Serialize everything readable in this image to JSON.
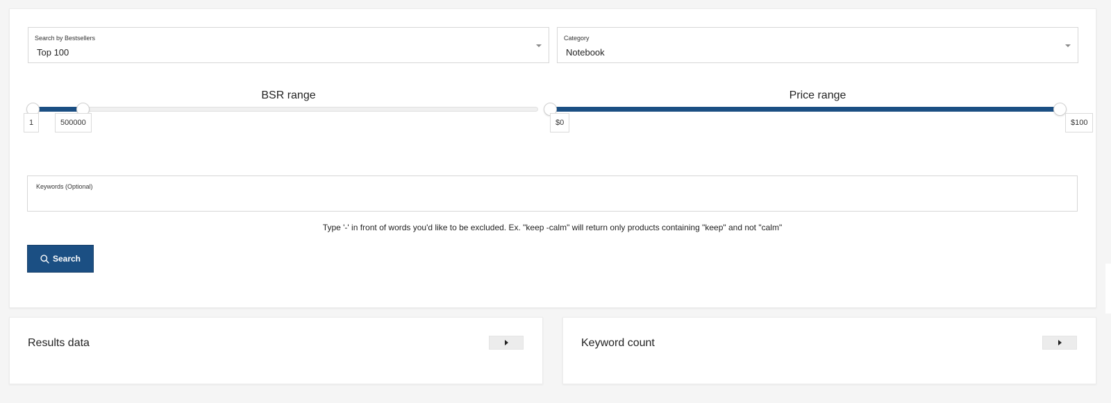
{
  "search_panel": {
    "bestsellers_select": {
      "label": "Search by Bestsellers",
      "value": "Top 100"
    },
    "category_select": {
      "label": "Category",
      "value": "Notebook"
    },
    "bsr_range": {
      "title": "BSR range",
      "min_label": "1",
      "max_label": "500000",
      "range_max": 5000000,
      "low": 1,
      "high": 500000
    },
    "price_range": {
      "title": "Price range",
      "min_label": "$0",
      "max_label": "$100",
      "range_max": 100,
      "low": 0,
      "high": 100
    },
    "keywords": {
      "label": "Keywords (Optional)",
      "value": ""
    },
    "hint": "Type '-' in front of words you'd like to be excluded. Ex. \"keep -calm\" will return only products containing \"keep\" and not \"calm\"",
    "search_button": {
      "label": "Search",
      "color": "#1b4f83"
    }
  },
  "panels": {
    "results": {
      "title": "Results data"
    },
    "keyword_count": {
      "title": "Keyword count"
    }
  },
  "icons": {
    "search": "magnifier-icon",
    "toggle": "triangle-right-icon",
    "dropdown": "caret-down-icon"
  }
}
